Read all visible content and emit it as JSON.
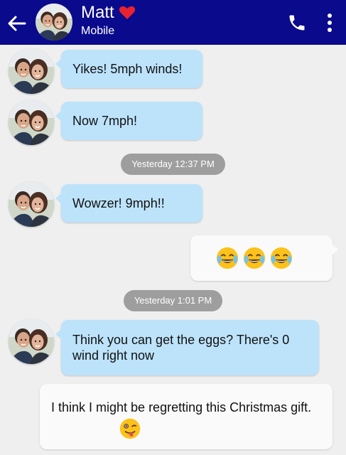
{
  "header": {
    "contact_name": "Matt",
    "subtitle": "Mobile",
    "bar_color": "#0a0a8c",
    "icons": [
      "back-arrow-icon",
      "heart-icon",
      "phone-icon",
      "more-vert-icon"
    ]
  },
  "messages": [
    {
      "direction": "incoming",
      "text": "Yikes! 5mph winds!"
    },
    {
      "direction": "incoming",
      "text": "Now 7mph!"
    },
    {
      "direction": "timestamp",
      "text": "Yesterday 12:37 PM"
    },
    {
      "direction": "incoming",
      "text": "Wowzer! 9mph!!"
    },
    {
      "direction": "outgoing",
      "text": "😂😂😂"
    },
    {
      "direction": "timestamp",
      "text": "Yesterday 1:01 PM"
    },
    {
      "direction": "incoming",
      "text": "Think you can get the eggs? There's 0 wind right now"
    },
    {
      "direction": "outgoing",
      "text": "I think I might be regretting this Christmas gift."
    }
  ],
  "colors": {
    "incoming_bubble": "#bde3fb",
    "outgoing_bubble": "#fafafa",
    "timestamp_pill": "#9e9e9e",
    "background": "#efefef"
  }
}
